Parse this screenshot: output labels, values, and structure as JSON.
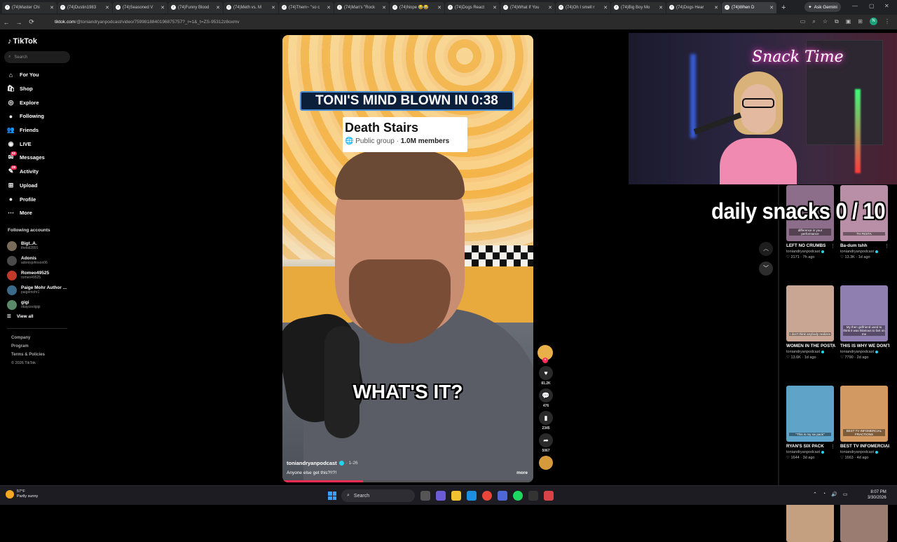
{
  "browser": {
    "tabs": [
      {
        "title": "(74)Master Chi"
      },
      {
        "title": "(74)Dustin1983"
      },
      {
        "title": "(74)Seasoned V"
      },
      {
        "title": "(74)Funny Blood"
      },
      {
        "title": "(74)Meth vs. M"
      },
      {
        "title": "(74)Them~ \"so c"
      },
      {
        "title": "(74)Man's \"Rock"
      },
      {
        "title": "(74)Nope 😂😂"
      },
      {
        "title": "(74)Dogs React"
      },
      {
        "title": "(74)What If You"
      },
      {
        "title": "(74)Oh I smell r"
      },
      {
        "title": "(74)Big Boy Mo"
      },
      {
        "title": "(74)Dogs Hear"
      },
      {
        "title": "(74)When D"
      }
    ],
    "new_tab": "+",
    "ask_gemini": "Ask Gemini",
    "url_host": "tiktok.com",
    "url_path": "/@toniandryanpodcast/video/7599818840196875757?_r=1&_t=ZS-95312z8oxmv",
    "profile_initial": "N"
  },
  "sidebar": {
    "logo": "TikTok",
    "search_placeholder": "Search",
    "nav": [
      {
        "label": "For You",
        "icon": "home-icon"
      },
      {
        "label": "Shop",
        "icon": "shop-icon"
      },
      {
        "label": "Explore",
        "icon": "compass-icon"
      },
      {
        "label": "Following",
        "icon": "following-icon"
      },
      {
        "label": "Friends",
        "icon": "friends-icon"
      },
      {
        "label": "LIVE",
        "icon": "live-icon"
      },
      {
        "label": "Messages",
        "icon": "messages-icon",
        "badge": "52"
      },
      {
        "label": "Activity",
        "icon": "activity-icon",
        "badge": "29"
      },
      {
        "label": "Upload",
        "icon": "upload-icon"
      },
      {
        "label": "Profile",
        "icon": "profile-icon"
      },
      {
        "label": "More",
        "icon": "more-icon"
      }
    ],
    "following_title": "Following accounts",
    "accounts": [
      {
        "name": "Bigt..A.",
        "handle": "thekid2891"
      },
      {
        "name": "Adonis",
        "handle": "adonisjohnson06"
      },
      {
        "name": "Romeo49525",
        "handle": "romeo49525"
      },
      {
        "name": "Paige Mohr Author ...",
        "handle": "paigemohr1"
      },
      {
        "name": "gigi",
        "handle": "okaycoolgigi"
      }
    ],
    "view_all": "View all",
    "footer": [
      "Company",
      "Program",
      "Terms & Policies"
    ],
    "copyright": "© 2026 TikTok"
  },
  "video": {
    "caption_top": "TONI'S MIND BLOWN IN 0:38",
    "group_name": "Death Stairs",
    "group_type": "Public group",
    "group_members": "1.0M members",
    "caption_bottom": "WHAT'S IT?",
    "author": "toniandryanpodcast",
    "date": "· 1-26",
    "description": "Anyone else get this?!!?!",
    "more": "more",
    "progress": 0.32
  },
  "actions": {
    "likes": "81.2K",
    "comments": "476",
    "saves": "2345",
    "shares": "5067"
  },
  "overlay": {
    "sign": "Snack Time",
    "counter_text": "daily snacks  0 / 10"
  },
  "related": [
    {
      "title": "LEFT NO CRUMBS",
      "author": "toniandryanpodcast",
      "likes": "2171",
      "age": "7h ago",
      "thumb_caption": "difference in your performance",
      "color": "#8d6e8a"
    },
    {
      "title": "Ba-dum tshh",
      "author": "toniandryanpodcast",
      "likes": "13.3K",
      "age": "1d ago",
      "thumb_caption": "TH FESTA",
      "color": "#b88fa6"
    },
    {
      "title": "WOMEN IN THE POSTAL SERVICE",
      "author": "toniandryanpodcast",
      "likes": "13.6K",
      "age": "1d ago",
      "thumb_caption": "I don't think anybody realizes",
      "color": "#c9a593"
    },
    {
      "title": "THIS IS WHY WE DON'T DO...",
      "author": "toniandryanpodcast",
      "likes": "7790",
      "age": "2d ago",
      "thumb_caption": "My then girlfriend used to think it was hilarious to fart on me",
      "color": "#8f7fb0"
    },
    {
      "title": "RYAN'S SIX PACK",
      "author": "toniandryanpodcast",
      "likes": "1644",
      "age": "3d ago",
      "thumb_caption": "\"This is my six pack\"",
      "color": "#5fa3c9"
    },
    {
      "title": "BEST TV INFOMERCIAL...",
      "author": "toniandryanpodcast",
      "likes": "1663",
      "age": "4d ago",
      "thumb_caption": "BEST TV INFOMERCIAL FRACTIONS",
      "color": "#d29a62"
    },
    {
      "title": "",
      "author": "",
      "likes": "",
      "age": "",
      "thumb_caption": "",
      "color": "#c4a080"
    },
    {
      "title": "",
      "author": "",
      "likes": "",
      "age": "",
      "thumb_caption": "",
      "color": "#9a7c70"
    }
  ],
  "taskbar": {
    "temp": "57°F",
    "condition": "Partly sunny",
    "search": "Search",
    "time": "8:07 PM",
    "date": "3/30/2026"
  }
}
